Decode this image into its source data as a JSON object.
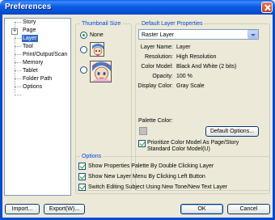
{
  "window": {
    "title": "Preferences"
  },
  "tree": {
    "items": [
      {
        "label": "Story"
      },
      {
        "label": "Page",
        "expander": "+"
      },
      {
        "label": "Layer",
        "selected": true
      },
      {
        "label": "Tool"
      },
      {
        "label": "Print/Output/Scan"
      },
      {
        "label": "Memory"
      },
      {
        "label": "Tablet"
      },
      {
        "label": "Folder Path"
      },
      {
        "label": "Options"
      }
    ]
  },
  "thumbnail": {
    "legend": "Thumbnail Size",
    "options": [
      {
        "label": "None",
        "checked": true
      },
      {
        "label": "",
        "checked": false
      },
      {
        "label": "",
        "checked": false
      }
    ]
  },
  "default_layer": {
    "legend": "Default Layer Properties",
    "select_value": "Raster Layer",
    "properties": [
      {
        "label": "Layer Name:",
        "value": "Layer"
      },
      {
        "label": "Resolution:",
        "value": "High Resolution"
      },
      {
        "label": "Color Model:",
        "value": "Black And White (2 bits)"
      },
      {
        "label": "Opacity:",
        "value": "100 %"
      },
      {
        "label": "Display Color:",
        "value": "Gray Scale"
      }
    ],
    "palette_label": "Palette Color:",
    "palette_color": "#c0c0c0",
    "default_options_button": "Default Options...",
    "prioritize_line1": "Prioritize Color Model As Page/Story",
    "prioritize_line2": "Standard Color Model(U)",
    "prioritize_checked": true
  },
  "options": {
    "legend": "Options",
    "items": [
      {
        "label": "Show Properties Palette By Double Clicking Layer",
        "checked": true
      },
      {
        "label": "Show New Layer Menu By Clicking Left Button",
        "checked": true
      },
      {
        "label": "Switch Editing Subject Using New Tone/New Text Layer",
        "checked": true
      }
    ]
  },
  "buttons": {
    "import": "Import...",
    "export": "Export(W)...",
    "ok": "OK",
    "cancel": "Cancel"
  },
  "colors": {
    "titlebar": "#0a5ce8",
    "legend_text": "#0046d5",
    "selection": "#316ac5",
    "check": "#21a121"
  }
}
